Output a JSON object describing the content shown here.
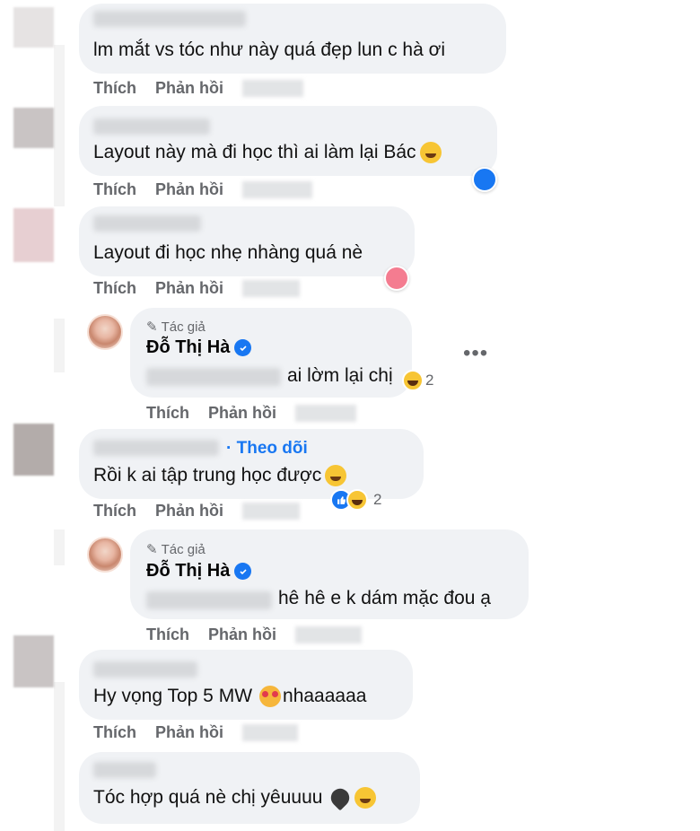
{
  "actions": {
    "like": "Thích",
    "reply": "Phản hồi"
  },
  "author": {
    "tag": "Tác giả",
    "name": "Đỗ Thị Hà"
  },
  "comments": [
    {
      "text": "lm mắt vs tóc như này quá đẹp lun c hà ơi"
    },
    {
      "text": "Layout này mà đi học thì ai làm lại Bác"
    },
    {
      "text": "Layout đi học nhẹ nhàng quá nè"
    },
    {
      "text": "Rồi k ai tập trung học được",
      "follow": "Theo dõi"
    },
    {
      "text": "Hy vọng Top 5 MW",
      "text_suffix": "nhaaaaaa"
    },
    {
      "text": "Tóc hợp quá nè chị yêuuuu"
    }
  ],
  "replies": [
    {
      "text": "ai lờm lại chị",
      "reaction_count": "2"
    },
    {
      "text": "hê hê e k dám mặc đou ạ"
    }
  ],
  "reactions": {
    "comment4_count": "2"
  },
  "more_label": "•••",
  "colors": {
    "bubble": "#f0f2f5",
    "link": "#1877f2",
    "muted": "#65676b"
  },
  "icons": [
    "like-icon",
    "haha-icon",
    "verified-icon",
    "pencil-icon",
    "more-icon"
  ]
}
